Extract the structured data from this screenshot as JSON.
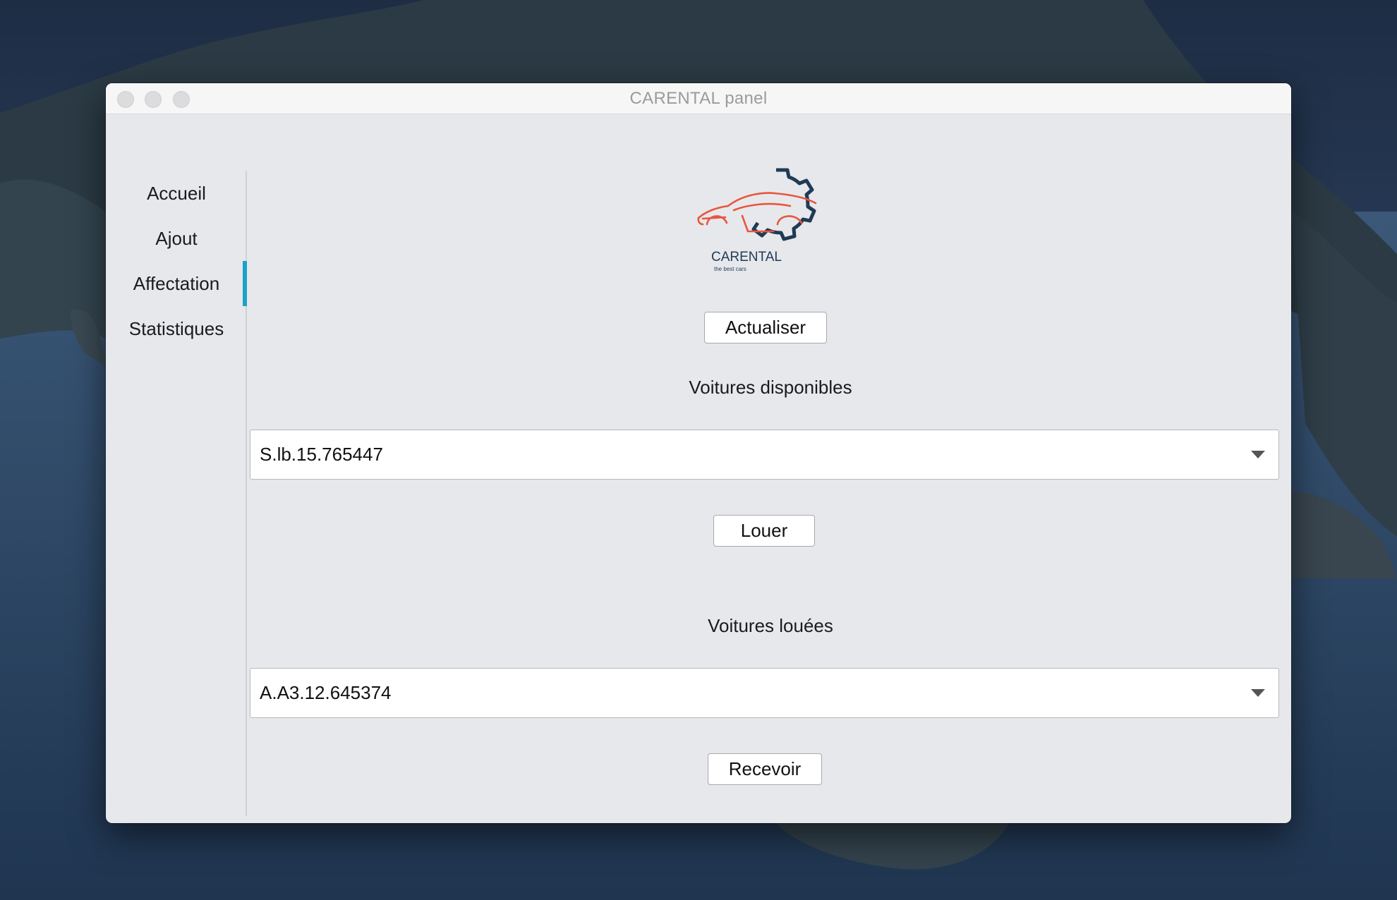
{
  "window": {
    "title": "CARENTAL panel"
  },
  "sidebar": {
    "items": [
      {
        "label": "Accueil",
        "active": false
      },
      {
        "label": "Ajout",
        "active": false
      },
      {
        "label": "Affectation",
        "active": true
      },
      {
        "label": "Statistiques",
        "active": false
      }
    ]
  },
  "logo": {
    "name": "CARENTAL",
    "tagline": "the best cars",
    "icons": [
      "car-outline-icon",
      "gear-icon"
    ]
  },
  "main": {
    "refresh_button": "Actualiser",
    "available_label": "Voitures disponibles",
    "available_selected": "S.lb.15.765447",
    "rent_button": "Louer",
    "rented_label": "Voitures louées",
    "rented_selected": "A.A3.12.645374",
    "receive_button": "Recevoir"
  },
  "colors": {
    "accent": "#1aa3c8",
    "logo_car": "#e8563f",
    "logo_gear": "#1f3b55"
  }
}
